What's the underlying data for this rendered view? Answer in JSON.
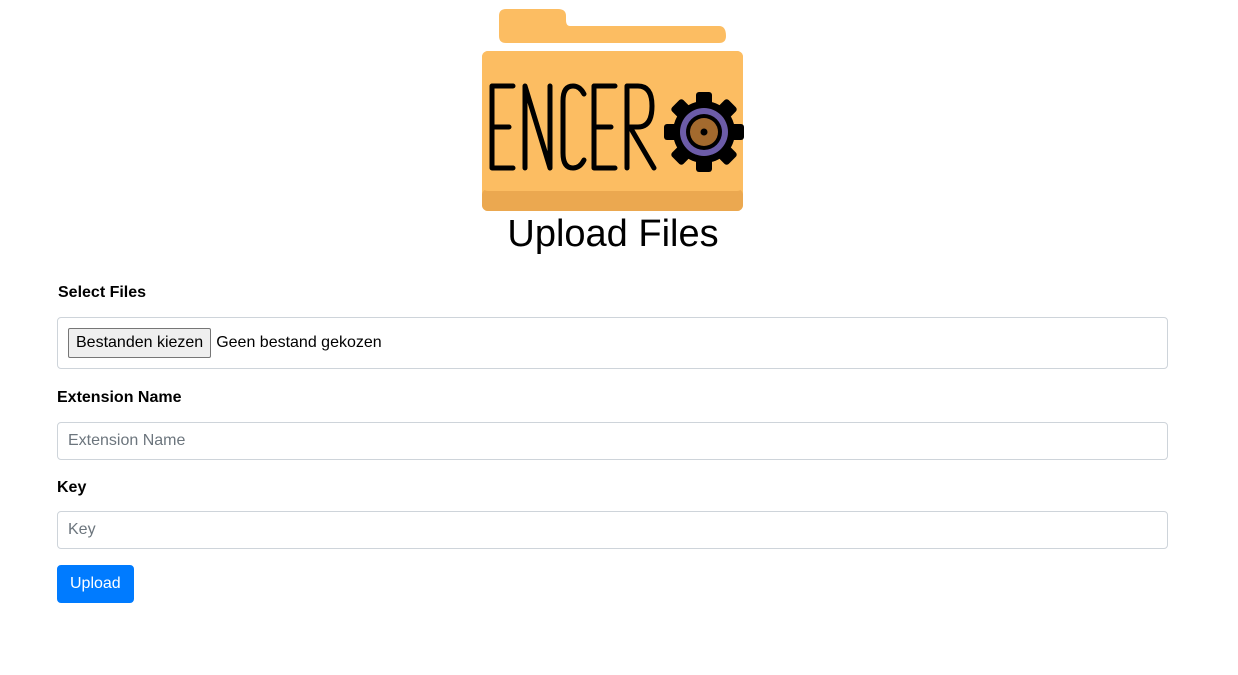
{
  "logo": {
    "text": "ENCERO",
    "icon": "folder-gear-logo",
    "colors": {
      "folder": "#FCBD62",
      "folder_shade": "#EBA850",
      "ink": "#000000",
      "gear_ring": "#6C5CA8",
      "gear_center": "#A36A2E"
    }
  },
  "page": {
    "title": "Upload Files"
  },
  "form": {
    "files": {
      "label": "Select Files",
      "button_label": "Bestanden kiezen",
      "status": "Geen bestand gekozen"
    },
    "extension": {
      "label": "Extension Name",
      "placeholder": "Extension Name",
      "value": ""
    },
    "key": {
      "label": "Key",
      "placeholder": "Key",
      "value": ""
    },
    "submit_label": "Upload"
  },
  "colors": {
    "primary": "#007bff",
    "input_border": "#ced4da"
  }
}
